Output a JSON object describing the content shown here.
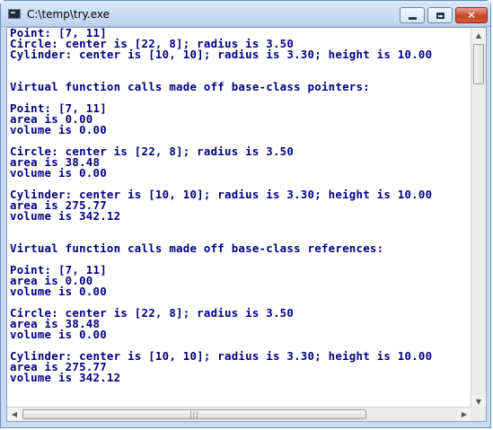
{
  "window": {
    "title": "C:\\temp\\try.exe"
  },
  "controls": {
    "close_glyph": "✕"
  },
  "console": {
    "lines": [
      "Point: [7, 11]",
      "Circle: center is [22, 8]; radius is 3.50",
      "Cylinder: center is [10, 10]; radius is 3.30; height is 10.00",
      "",
      "",
      "Virtual function calls made off base-class pointers:",
      "",
      "Point: [7, 11]",
      "area is 0.00",
      "volume is 0.00",
      "",
      "Circle: center is [22, 8]; radius is 3.50",
      "area is 38.48",
      "volume is 0.00",
      "",
      "Cylinder: center is [10, 10]; radius is 3.30; height is 10.00",
      "area is 275.77",
      "volume is 342.12",
      "",
      "",
      "Virtual function calls made off base-class references:",
      "",
      "Point: [7, 11]",
      "area is 0.00",
      "volume is 0.00",
      "",
      "Circle: center is [22, 8]; radius is 3.50",
      "area is 38.48",
      "volume is 0.00",
      "",
      "Cylinder: center is [10, 10]; radius is 3.30; height is 10.00",
      "area is 275.77",
      "volume is 342.12"
    ]
  },
  "scrollbars": {
    "up_arrow": "▲",
    "down_arrow": "▼",
    "left_arrow": "◀",
    "right_arrow": "▶",
    "grip": "|||"
  },
  "colors": {
    "console_text": "#000080",
    "console_background": "#ffffff"
  }
}
